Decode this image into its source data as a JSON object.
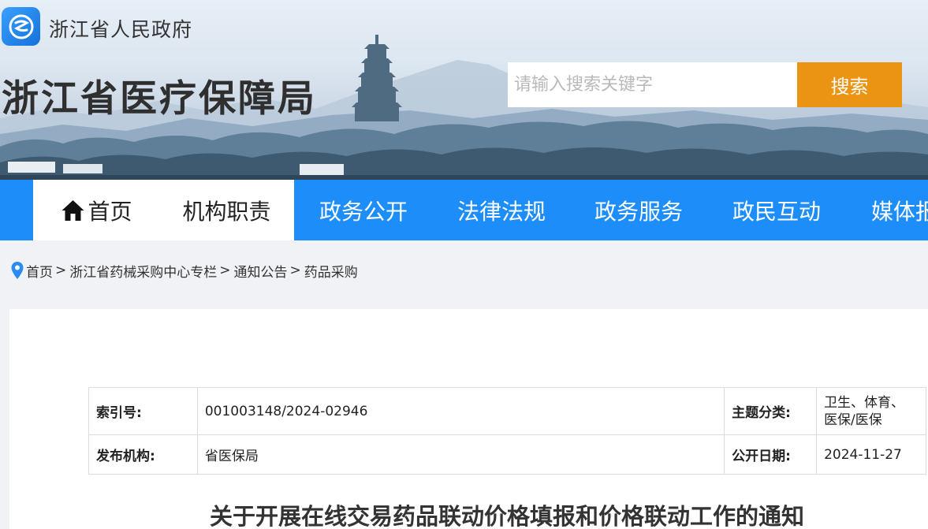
{
  "header": {
    "gov_name": "浙江省人民政府",
    "bureau_title": "浙江省医疗保障局",
    "search": {
      "placeholder": "请输入搜索关键字",
      "button_label": "搜索"
    },
    "logo_icon": "zhejiang-gov-logo-icon"
  },
  "nav": {
    "items": [
      {
        "label": "首页",
        "icon": "home-icon",
        "active": true
      },
      {
        "label": "机构职责",
        "active": true
      },
      {
        "label": "政务公开"
      },
      {
        "label": "法律法规"
      },
      {
        "label": "政务服务"
      },
      {
        "label": "政民互动"
      },
      {
        "label": "媒体报"
      }
    ]
  },
  "breadcrumb": {
    "icon": "location-pin-icon",
    "items": [
      "首页",
      "浙江省药械采购中心专栏",
      "通知公告",
      "药品采购"
    ],
    "separator": ">"
  },
  "meta": {
    "index_label": "索引号:",
    "index_value": "001003148/2024-02946",
    "topic_label": "主题分类:",
    "topic_value_line1": "卫生、体育、",
    "topic_value_line2": "医保/医保",
    "publisher_label": "发布机构:",
    "publisher_value": "省医保局",
    "date_label": "公开日期:",
    "date_value": "2024-11-27"
  },
  "document": {
    "title": "关于开展在线交易药品联动价格填报和价格联动工作的通知"
  },
  "colors": {
    "nav_blue": "#1d8dfa",
    "search_orange": "#eb9413",
    "pin_blue": "#2a8cf3"
  }
}
